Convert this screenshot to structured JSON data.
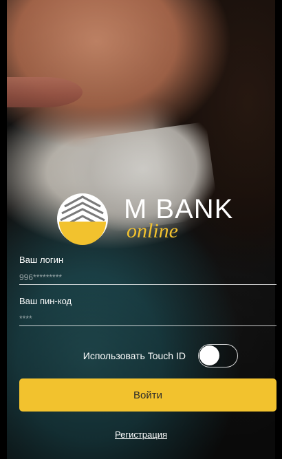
{
  "brand": {
    "word": "M BANK",
    "script": "online",
    "accent_color": "#f2c22e"
  },
  "form": {
    "login": {
      "label": "Ваш логин",
      "placeholder": "996*********"
    },
    "pin": {
      "label": "Ваш пин-код",
      "placeholder": "****"
    }
  },
  "touch_id": {
    "label": "Использовать Touch ID",
    "enabled": false
  },
  "actions": {
    "login_label": "Войти",
    "register_label": "Регистрация"
  }
}
